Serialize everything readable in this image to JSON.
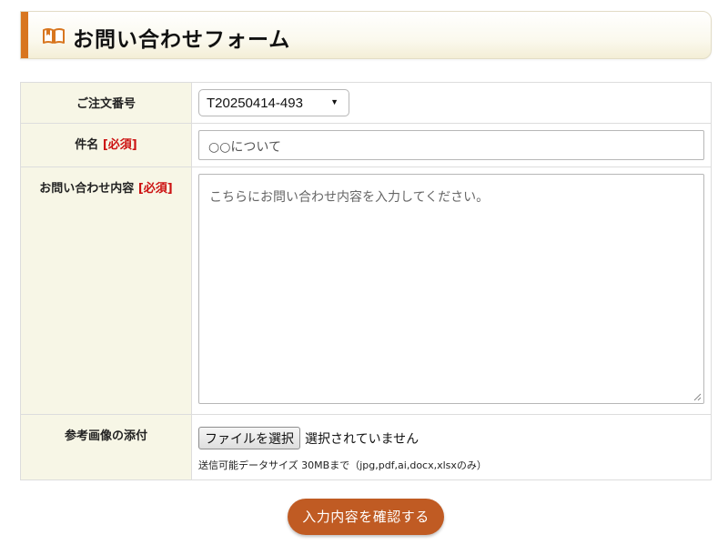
{
  "header": {
    "title": "お問い合わせフォーム",
    "icon": "open-book-icon",
    "accent_color": "#d8761f"
  },
  "form": {
    "required_label": "[必須]",
    "order_number": {
      "label": "ご注文番号",
      "selected_value": "T20250414-493"
    },
    "subject": {
      "label": "件名",
      "placeholder": "○○について"
    },
    "message": {
      "label": "お問い合わせ内容",
      "placeholder": "こちらにお問い合わせ内容を入力してください。"
    },
    "attachment": {
      "label": "参考画像の添付",
      "button_label": "ファイルを選択",
      "status": "選択されていません",
      "note": "送信可能データサイズ 30MBまで（jpg,pdf,ai,docx,xlsxのみ）"
    },
    "submit_label": "入力内容を確認する",
    "submit_color": "#c05b23"
  }
}
